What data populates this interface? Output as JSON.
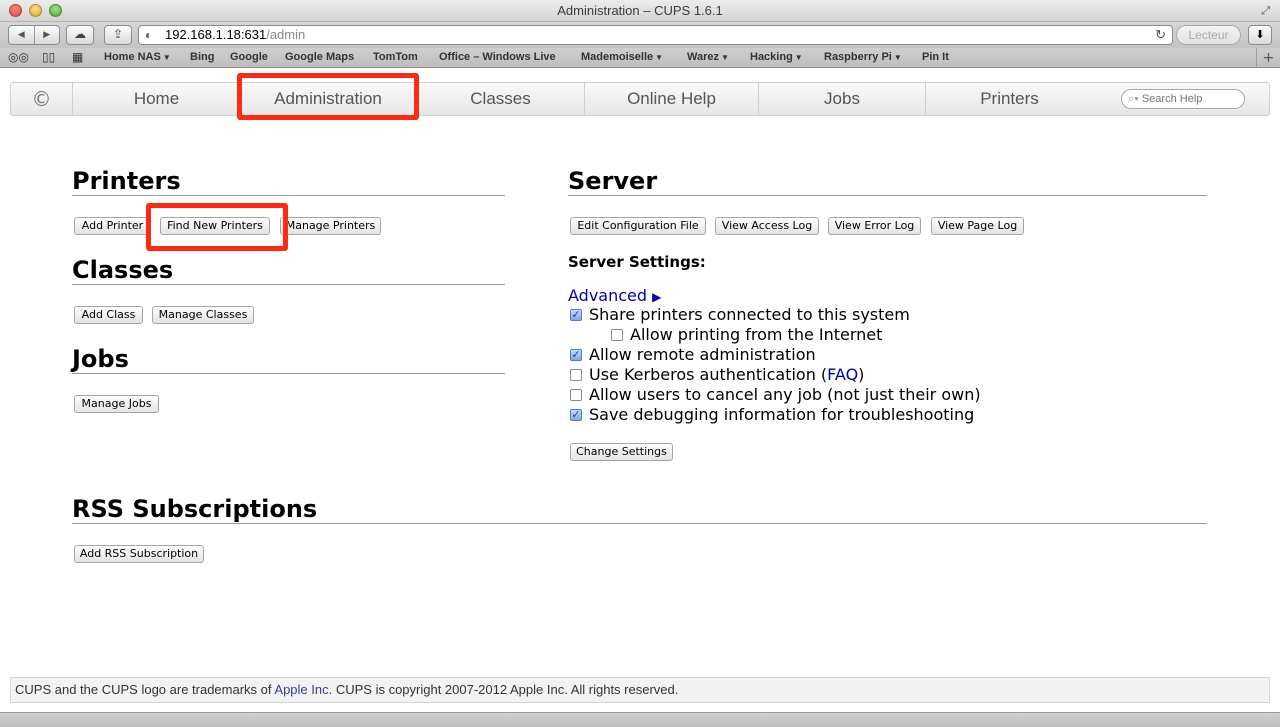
{
  "window": {
    "title": "Administration – CUPS 1.6.1"
  },
  "toolbar": {
    "back_icon": "back-arrow-icon",
    "forward_icon": "forward-arrow-icon",
    "url_host": "192.168.1.18:631",
    "url_path": "/admin",
    "reader_label": "Lecteur"
  },
  "bookmarks": [
    {
      "label": "Home NAS",
      "menu": true
    },
    {
      "label": "Bing",
      "menu": false
    },
    {
      "label": "Google",
      "menu": false
    },
    {
      "label": "Google Maps",
      "menu": false
    },
    {
      "label": "TomTom",
      "menu": false
    },
    {
      "label": "Office – Windows Live",
      "menu": false
    },
    {
      "label": "Mademoiselle",
      "menu": true
    },
    {
      "label": "Warez",
      "menu": true
    },
    {
      "label": "Hacking",
      "menu": true
    },
    {
      "label": "Raspberry Pi",
      "menu": true
    },
    {
      "label": "Pin It",
      "menu": false
    }
  ],
  "nav": {
    "tabs": [
      {
        "label": "Home"
      },
      {
        "label": "Administration",
        "active": true
      },
      {
        "label": "Classes"
      },
      {
        "label": "Online Help"
      },
      {
        "label": "Jobs"
      },
      {
        "label": "Printers"
      }
    ],
    "search_placeholder": "Search Help"
  },
  "printers": {
    "title": "Printers",
    "buttons": [
      "Add Printer",
      "Find New Printers",
      "Manage Printers"
    ]
  },
  "classes": {
    "title": "Classes",
    "buttons": [
      "Add Class",
      "Manage Classes"
    ]
  },
  "jobs": {
    "title": "Jobs",
    "buttons": [
      "Manage Jobs"
    ]
  },
  "server": {
    "title": "Server",
    "buttons": [
      "Edit Configuration File",
      "View Access Log",
      "View Error Log",
      "View Page Log"
    ],
    "settings_title": "Server Settings:",
    "advanced_label": "Advanced",
    "advanced_icon": "triangle-right-icon",
    "settings": [
      {
        "label": "Share printers connected to this system",
        "checked": true
      },
      {
        "label": "Allow printing from the Internet",
        "checked": false
      },
      {
        "label": "Allow remote administration",
        "checked": true
      },
      {
        "label": "Use Kerberos authentication (",
        "link": "FAQ",
        "suffix": ")",
        "checked": false
      },
      {
        "label": "Allow users to cancel any job (not just their own)",
        "checked": false
      },
      {
        "label": "Save debugging information for troubleshooting",
        "checked": true
      }
    ],
    "change_button": "Change Settings"
  },
  "rss": {
    "title": "RSS Subscriptions",
    "button": "Add RSS Subscription"
  },
  "footer": {
    "text_before": "CUPS and the CUPS logo are trademarks of ",
    "link": "Apple Inc.",
    "text_after": " CUPS is copyright 2007-2012 Apple Inc. All rights reserved."
  },
  "colors": {
    "highlight": "#ff2a12",
    "link": "#0000a8"
  }
}
